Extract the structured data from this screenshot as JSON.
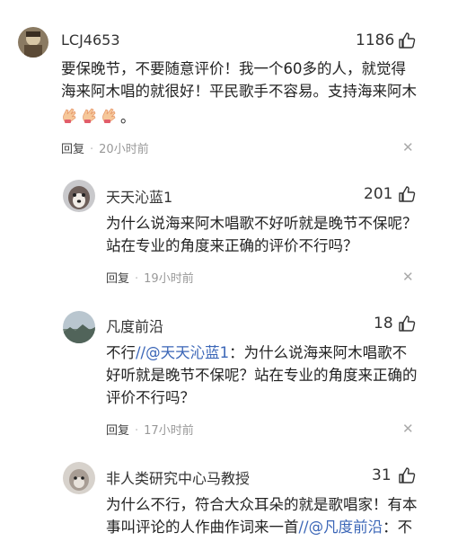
{
  "comments": [
    {
      "username": "LCJ4653",
      "likes": "1186",
      "lines": [
        "要保晚节，不要随意评价！我一个60多的人，就觉得",
        "海来阿木唱的就很好！平民歌手不容易。支持海来阿木"
      ],
      "emoji_suffix": "。",
      "reply_label": "回复",
      "time": "20小时前"
    },
    {
      "username": "天天沁蓝1",
      "likes": "201",
      "lines": [
        "为什么说海来阿木唱歌不好听就是晚节不保呢？",
        "站在专业的角度来正确的评价不行吗？"
      ],
      "reply_label": "回复",
      "time": "19小时前"
    },
    {
      "username": "凡度前沿",
      "likes": "18",
      "line1_prefix": "不行",
      "line1_mention": "//@天天沁蓝1",
      "line1_rest": "：为什么说海来阿木唱歌不",
      "lines": [
        "好听就是晚节不保呢？站在专业的角度来正确的",
        "评价不行吗？"
      ],
      "reply_label": "回复",
      "time": "17小时前"
    },
    {
      "username": "非人类研究中心马教授",
      "likes": "31",
      "line1": "为什么不行，符合大众耳朵的就是歌唱家！有本",
      "line2_prefix": "事叫评论的人作曲作词来一首",
      "line2_mention": "//@凡度前沿",
      "line2_rest": "：不"
    }
  ],
  "icons": {
    "like": "thumbs-up-icon",
    "close": "close-icon",
    "clap": "clapping-hands-icon"
  },
  "colors": {
    "mention": "#3b66b7",
    "meta_time": "#999999"
  }
}
